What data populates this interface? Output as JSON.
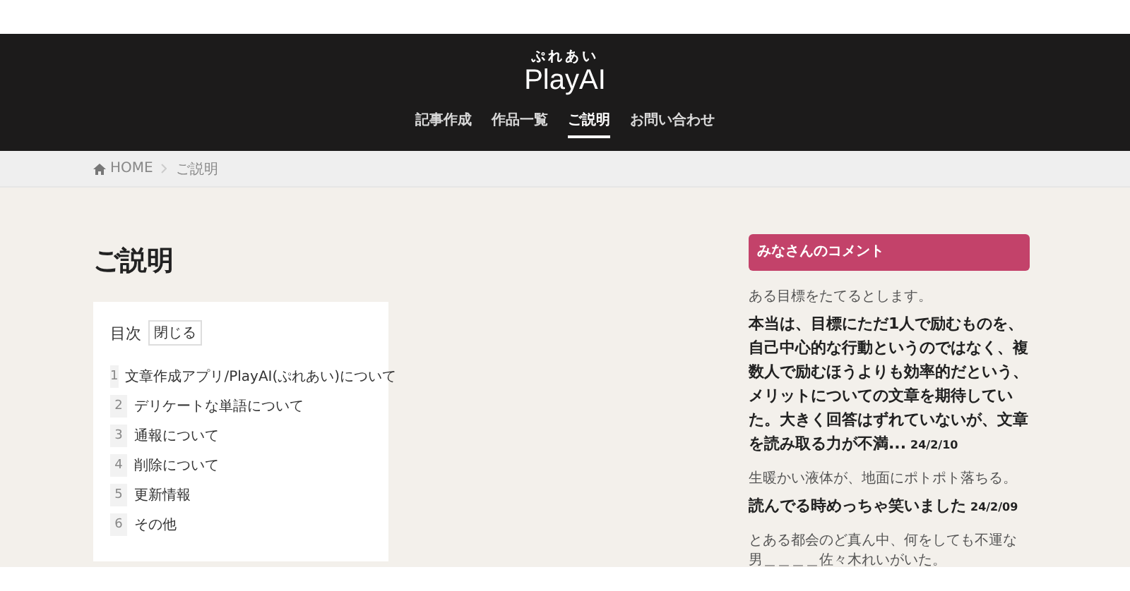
{
  "logo": {
    "kana": "ぷれあい",
    "name": "PlayAI"
  },
  "nav": [
    {
      "label": "記事作成",
      "selected": false
    },
    {
      "label": "作品一覧",
      "selected": false
    },
    {
      "label": "ご説明",
      "selected": true
    },
    {
      "label": "お問い合わせ",
      "selected": false
    }
  ],
  "breadcrumb": [
    {
      "label": "HOME",
      "kind": "home"
    },
    {
      "label": "ご説明",
      "kind": "current"
    }
  ],
  "page_title": "ご説明",
  "toc": {
    "title": "目次",
    "toggle": "閉じる",
    "items": [
      {
        "number": "1",
        "label": "文章作成アプリ/PlayAI(ぷれあい)について"
      },
      {
        "number": "2",
        "label": "デリケートな単語について"
      },
      {
        "number": "3",
        "label": "通報について"
      },
      {
        "number": "4",
        "label": "削除について"
      },
      {
        "number": "5",
        "label": "更新情報"
      },
      {
        "number": "6",
        "label": "その他"
      }
    ]
  },
  "comments": {
    "heading": "みなさんのコメント",
    "items": [
      {
        "prompt": "ある目標をたてるとします。",
        "comment": "本当は、目標にただ1人で励むものを、自己中心的な行動というのではなく、複数人で励むほうよりも効率的だという、メリットについての文章を期待していた。大きく回答はずれていないが、文章を読み取る力が不満...",
        "date": "24/2/10"
      },
      {
        "prompt": "生暖かい液体が、地面にポトポト落ちる。",
        "comment": "読んでる時めっちゃ笑いました",
        "date": "24/2/09"
      },
      {
        "prompt": "とある都会のど真ん中、何をしても不運な男＿＿＿＿佐々木れいがいた。"
      }
    ]
  }
}
